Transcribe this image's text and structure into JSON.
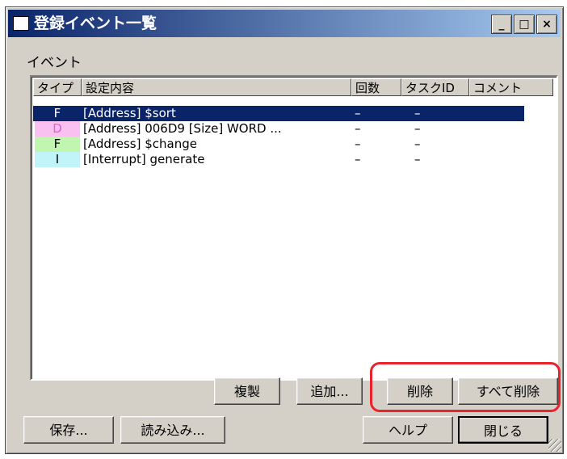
{
  "window": {
    "title": "登録イベント一覧",
    "buttons": {
      "minimize": "_",
      "maximize": "□",
      "close": "×"
    }
  },
  "group_label": "イベント",
  "list": {
    "headers": [
      "タイプ",
      "設定内容",
      "回数",
      "タスクID",
      "コメント"
    ],
    "rows": [
      {
        "type": "F",
        "content": "[Address] $sort",
        "count": "–",
        "task": "–",
        "selected": true,
        "type_color": "#0a246a"
      },
      {
        "type": "D",
        "content": "[Address] 006D9 [Size] WORD ...",
        "count": "–",
        "task": "–",
        "selected": false,
        "type_color": "#f9c0f0"
      },
      {
        "type": "F",
        "content": "[Address] $change",
        "count": "–",
        "task": "–",
        "selected": false,
        "type_color": "#c0f6b0"
      },
      {
        "type": "I",
        "content": "[Interrupt] generate",
        "count": "–",
        "task": "–",
        "selected": false,
        "type_color": "#c0f4f8"
      }
    ]
  },
  "buttons": {
    "duplicate": "複製",
    "add": "追加...",
    "delete": "削除",
    "delete_all": "すべて削除",
    "save": "保存...",
    "load": "読み込み...",
    "help": "ヘルプ",
    "close": "閉じる"
  },
  "colors": {
    "highlight": "#e8232b",
    "selection": "#0a246a"
  }
}
